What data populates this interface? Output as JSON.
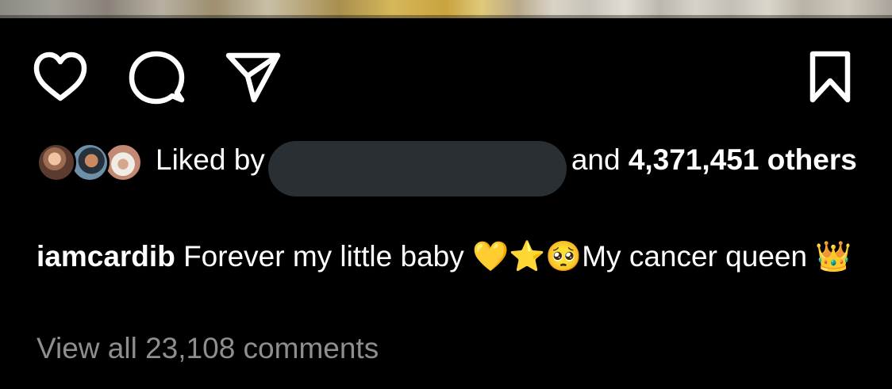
{
  "post_actions": {
    "like_icon": "heart-outline-icon",
    "comment_icon": "comment-bubble-icon",
    "share_icon": "paper-plane-icon",
    "save_icon": "bookmark-outline-icon"
  },
  "likes": {
    "prefix": "Liked by",
    "connector": "and",
    "count": "4,371,451",
    "suffix": "others"
  },
  "caption": {
    "username": "iamcardib",
    "text": "Forever my little baby 💛⭐🥺My cancer queen 👑"
  },
  "comments": {
    "view_all_label": "View all 23,108 comments"
  },
  "colors": {
    "background": "#000000",
    "text": "#ffffff",
    "muted_text": "#8e8e8e",
    "redaction": "#2a2f33"
  }
}
